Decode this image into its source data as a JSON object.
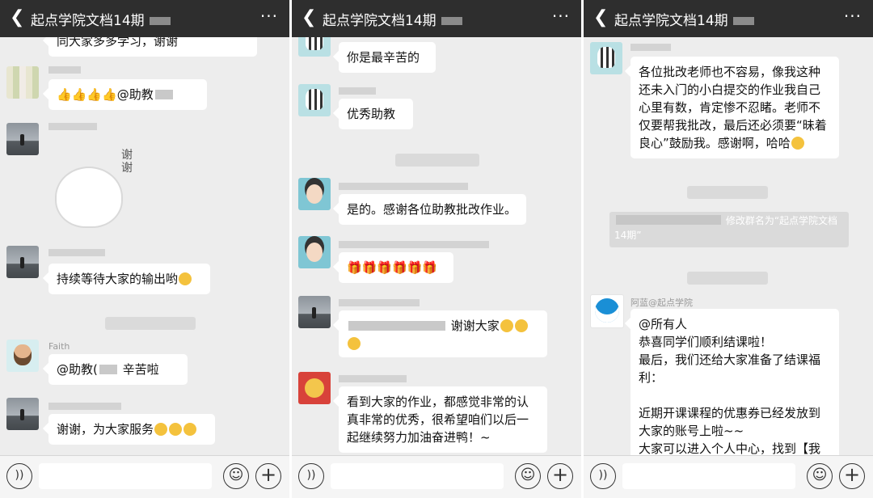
{
  "panels": [
    {
      "title": "起点学院文档14期",
      "messages": {
        "m0": "同大家多多学习，谢谢",
        "m1": "👍👍👍👍@助教",
        "sticker": "谢谢",
        "m2": "持续等待大家的输出哟",
        "m3_name": "Faith",
        "m3a": "@助教(",
        "m3b": "辛苦啦",
        "m4": "谢谢，为大家服务"
      }
    },
    {
      "title": "起点学院文档14期",
      "messages": {
        "m0": "你是最辛苦的",
        "m1": "优秀助教",
        "m2": "是的。感谢各位助教批改作业。",
        "m3": "🎁🎁🎁🎁🎁🎁",
        "m4": "谢谢大家",
        "m5": "看到大家的作业，都感觉非常的认真非常的优秀，很希望咱们以后一起继续努力加油奋进鸭！~"
      }
    },
    {
      "title": "起点学院文档14期",
      "messages": {
        "m0": "各位批改老师也不容易，像我这种还未入门的小白提交的作业我自己心里有数，肯定惨不忍睹。老师不仅要帮我批改，最后还必须要“昧着良心”鼓励我。感谢啊，哈哈",
        "sys": "修改群名为“起点学院文档14期”",
        "m1_name": "阿蓝@起点学院",
        "m1": "@所有人\n恭喜同学们顺利结课啦！\n最后，我们还给大家准备了结课福利：\n\n近期开课课程的优惠券已经发放到大家的账号上啦~~\n大家可以进入个人中心，找到【我"
      }
    }
  ],
  "icons": {
    "back": "chevron-left-icon",
    "more": "more-dots-icon",
    "voice": "voice-icon",
    "emoji": "emoji-icon",
    "plus": "plus-icon"
  }
}
